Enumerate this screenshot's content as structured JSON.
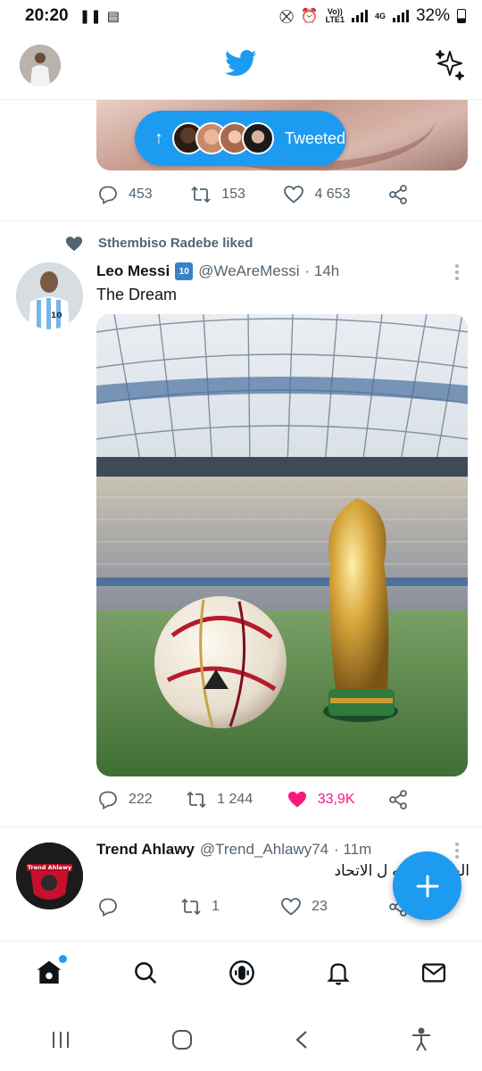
{
  "status_bar": {
    "time": "20:20",
    "volte": "Vo))",
    "lte": "LTE1",
    "network": "4G",
    "battery": "32%"
  },
  "icons": {
    "app_logo": "twitter-bird-icon",
    "sparkle": "sparkle-icon",
    "home": "home-icon",
    "search": "search-icon",
    "spaces": "spaces-icon",
    "notifications": "bell-icon",
    "messages": "mail-icon",
    "compose": "plus-icon"
  },
  "colors": {
    "brand": "#1d9bf0",
    "like_active": "#f91880",
    "text_secondary": "#536471"
  },
  "new_tweets_pill": {
    "label": "Tweeted"
  },
  "prev_tweet": {
    "replies": "453",
    "retweets": "153",
    "likes": "4 653"
  },
  "tweet": {
    "social_context": "Sthembiso Radebe liked",
    "author_name": "Leo Messi",
    "badge": "10",
    "handle": "@WeAreMessi",
    "time": "· 14h",
    "text": "The Dream",
    "replies": "222",
    "retweets": "1 244",
    "likes": "33,9K"
  },
  "next_tweet": {
    "author_name": "Trend Ahlawy",
    "handle": "@Trend_Ahlawy74",
    "time": "· 11m",
    "text": "الجزاء التانيه ل الاتحاد",
    "avatar_text": "Trend Ahlawy",
    "retweets": "1",
    "likes": "23"
  }
}
